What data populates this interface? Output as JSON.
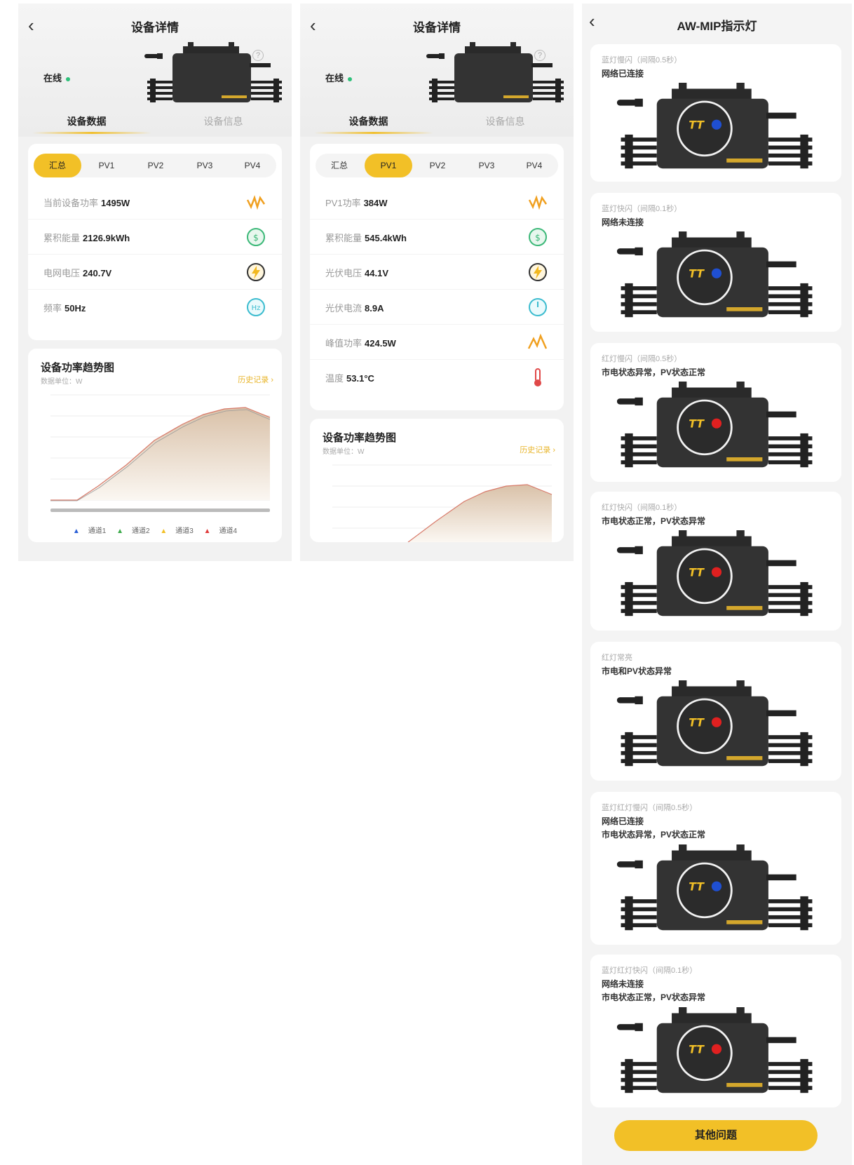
{
  "screen1": {
    "title": "设备详情",
    "status": "在线",
    "tabs": [
      "设备数据",
      "设备信息"
    ],
    "segments": [
      "汇总",
      "PV1",
      "PV2",
      "PV3",
      "PV4"
    ],
    "selected_segment": "汇总",
    "rows": [
      {
        "label": "当前设备功率",
        "value": "1495W",
        "icon": "power-wave-icon"
      },
      {
        "label": "累积能量",
        "value": "2126.9kWh",
        "icon": "energy-icon"
      },
      {
        "label": "电网电压",
        "value": "240.7V",
        "icon": "voltage-bolt-icon"
      },
      {
        "label": "频率",
        "value": "50Hz",
        "icon": "frequency-hz-icon"
      }
    ],
    "chart": {
      "title": "设备功率趋势图",
      "unit": "数据单位：W",
      "history_link": "历史记录",
      "legend": [
        "通道1",
        "通道2",
        "通道3",
        "通道4"
      ]
    }
  },
  "screen2": {
    "title": "设备详情",
    "status": "在线",
    "tabs": [
      "设备数据",
      "设备信息"
    ],
    "segments": [
      "汇总",
      "PV1",
      "PV2",
      "PV3",
      "PV4"
    ],
    "selected_segment": "PV1",
    "rows": [
      {
        "label": "PV1功率",
        "value": "384W",
        "icon": "power-wave-icon"
      },
      {
        "label": "累积能量",
        "value": "545.4kWh",
        "icon": "energy-icon"
      },
      {
        "label": "光伏电压",
        "value": "44.1V",
        "icon": "voltage-bolt-icon"
      },
      {
        "label": "光伏电流",
        "value": "8.9A",
        "icon": "current-gauge-icon"
      },
      {
        "label": "峰值功率",
        "value": "424.5W",
        "icon": "peak-power-icon"
      },
      {
        "label": "温度",
        "value": "53.1°C",
        "icon": "thermometer-icon"
      }
    ],
    "chart": {
      "title": "设备功率趋势图",
      "unit": "数据单位：W",
      "history_link": "历史记录"
    }
  },
  "screen3": {
    "title": "AW-MIP指示灯",
    "items": [
      {
        "l1": "蓝灯慢闪（间隔0.5秒）",
        "lines": [
          "网络已连接"
        ],
        "led": "#1f4fd1"
      },
      {
        "l1": "蓝灯快闪（间隔0.1秒）",
        "lines": [
          "网络未连接"
        ],
        "led": "#1f4fd1"
      },
      {
        "l1": "红灯慢闪（间隔0.5秒）",
        "lines": [
          "市电状态异常，PV状态正常"
        ],
        "led": "#e02020"
      },
      {
        "l1": "红灯快闪（间隔0.1秒）",
        "lines": [
          "市电状态正常，PV状态异常"
        ],
        "led": "#e02020"
      },
      {
        "l1": "红灯常亮",
        "lines": [
          "市电和PV状态异常"
        ],
        "led": "#e02020"
      },
      {
        "l1": "蓝灯红灯慢闪（间隔0.5秒）",
        "lines": [
          "网络已连接",
          "市电状态异常，PV状态正常"
        ],
        "led": "#1f4fd1"
      },
      {
        "l1": "蓝灯红灯快闪（间隔0.1秒）",
        "lines": [
          "网络未连接",
          "市电状态正常，PV状态异常"
        ],
        "led": "#e02020"
      }
    ],
    "button": "其他问题"
  },
  "colors": {
    "accent": "#f2c027",
    "online": "#2fc07a",
    "led_blue": "#1f4fd1",
    "led_red": "#e02020"
  }
}
